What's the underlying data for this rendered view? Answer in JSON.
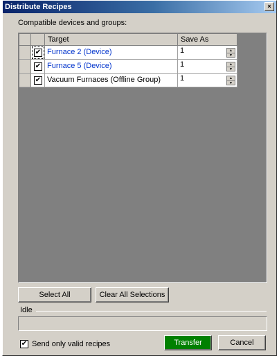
{
  "window": {
    "title": "Distribute Recipes",
    "close_glyph": "×"
  },
  "caption": "Compatible devices and groups:",
  "table": {
    "columns": [
      "",
      "",
      "Target",
      "Save As"
    ],
    "rows": [
      {
        "checked": "✔",
        "target": "Furnace 2 (Device)",
        "save_as": "1"
      },
      {
        "checked": "✔",
        "target": "Furnace 5 (Device)",
        "save_as": "1"
      },
      {
        "checked": "✔",
        "target": "Vacuum Furnaces (Offline Group)",
        "save_as": "1"
      }
    ],
    "spin_up": "▲",
    "spin_down": "▼"
  },
  "buttons": {
    "select_all": "Select All",
    "clear_all": "Clear All Selections",
    "transfer": "Transfer",
    "cancel": "Cancel"
  },
  "status": {
    "label": "Idle"
  },
  "options": {
    "valid_only_checked": "✔",
    "valid_only_label": "Send only valid recipes"
  },
  "colors": {
    "link": "#0033cc",
    "transfer_button": "#008000",
    "grid_background": "#808080"
  }
}
